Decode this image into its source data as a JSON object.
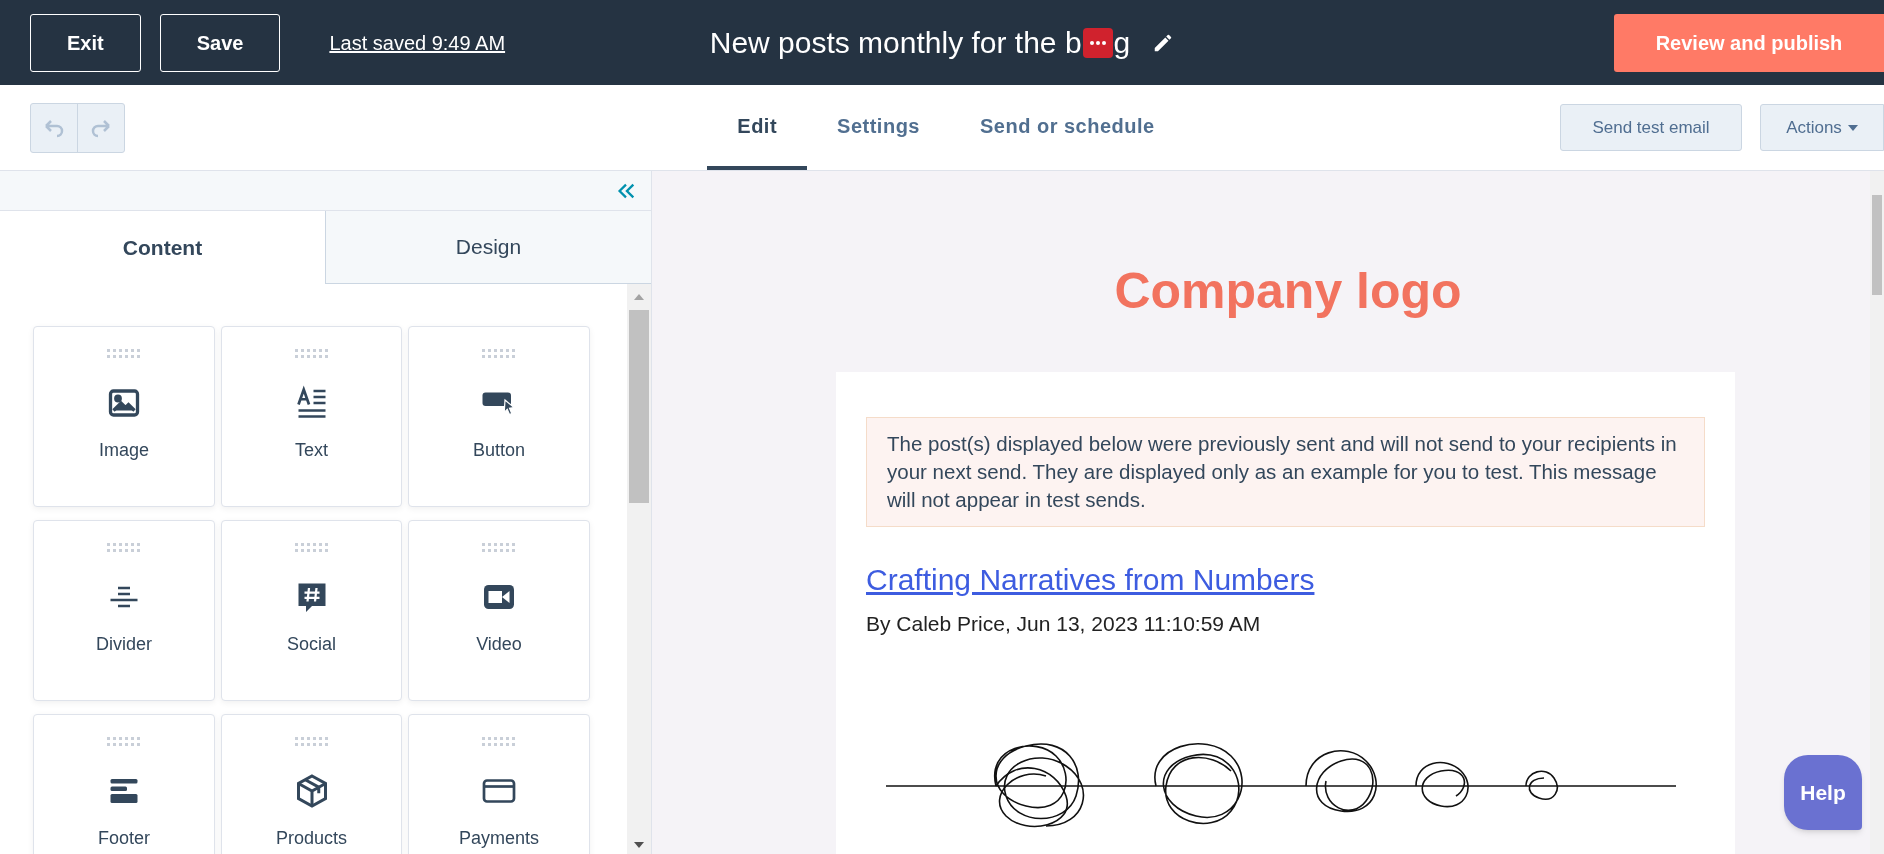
{
  "header": {
    "buttons": [
      {
        "label": "Exit"
      },
      {
        "label": "Save"
      }
    ],
    "last_saved": "Last saved 9:49 AM",
    "title": "New posts monthly for the b",
    "title_end": "g",
    "primary_button": "Review and publish"
  },
  "toolbar": {
    "tabs": [
      {
        "label": "Edit",
        "selected": true
      },
      {
        "label": "Settings",
        "selected": false
      },
      {
        "label": "Send or schedule",
        "selected": false
      }
    ],
    "test_button": "Send test email",
    "actions_button": "Actions"
  },
  "sidebar": {
    "tabs": [
      {
        "label": "Content",
        "selected": true
      },
      {
        "label": "Design",
        "selected": false
      }
    ],
    "modules": [
      {
        "label": "Image",
        "kind": "image"
      },
      {
        "label": "Text",
        "kind": "text"
      },
      {
        "label": "Button",
        "kind": "button"
      },
      {
        "label": "Divider",
        "kind": "divider"
      },
      {
        "label": "Social",
        "kind": "social"
      },
      {
        "label": "Video",
        "kind": "video"
      },
      {
        "label": "Footer",
        "kind": "footer"
      },
      {
        "label": "Products",
        "kind": "products"
      },
      {
        "label": "Payments",
        "kind": "payments"
      }
    ]
  },
  "preview": {
    "logo": "Company logo",
    "notice": "The post(s) displayed below were previously sent and will not send to your recipients in your next send. They are displayed only as an example for you to test. This message will not appear in test sends.",
    "post_title": "Crafting Narratives from Numbers",
    "byline": "By Caleb Price, Jun 13, 2023 11:10:59 AM"
  },
  "help_button": "Help"
}
